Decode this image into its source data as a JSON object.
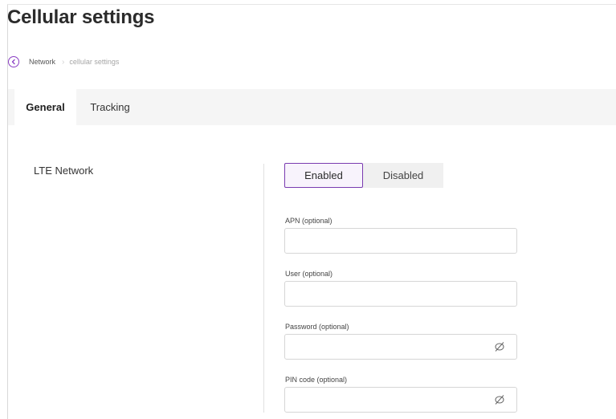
{
  "page": {
    "title": "Cellular settings"
  },
  "breadcrumb": {
    "back_icon": "chevron-left-icon",
    "parent": "Network",
    "separator": "›",
    "current": "cellular settings"
  },
  "tabs": [
    {
      "label": "General",
      "active": true
    },
    {
      "label": "Tracking",
      "active": false
    }
  ],
  "lte": {
    "section_label": "LTE Network",
    "toggle": {
      "enabled_label": "Enabled",
      "disabled_label": "Disabled",
      "selected": "Enabled"
    },
    "fields": {
      "apn": {
        "label": "APN (optional)",
        "value": ""
      },
      "user": {
        "label": "User (optional)",
        "value": ""
      },
      "password": {
        "label": "Password (optional)",
        "value": "",
        "icon": "eye-slash-icon"
      },
      "pin": {
        "label": "PIN code (optional)",
        "value": "",
        "icon": "eye-slash-icon"
      }
    }
  },
  "colors": {
    "accent": "#7a3bb0",
    "accent_bg": "#f8f3fc",
    "tab_bar_bg": "#f5f5f5"
  }
}
